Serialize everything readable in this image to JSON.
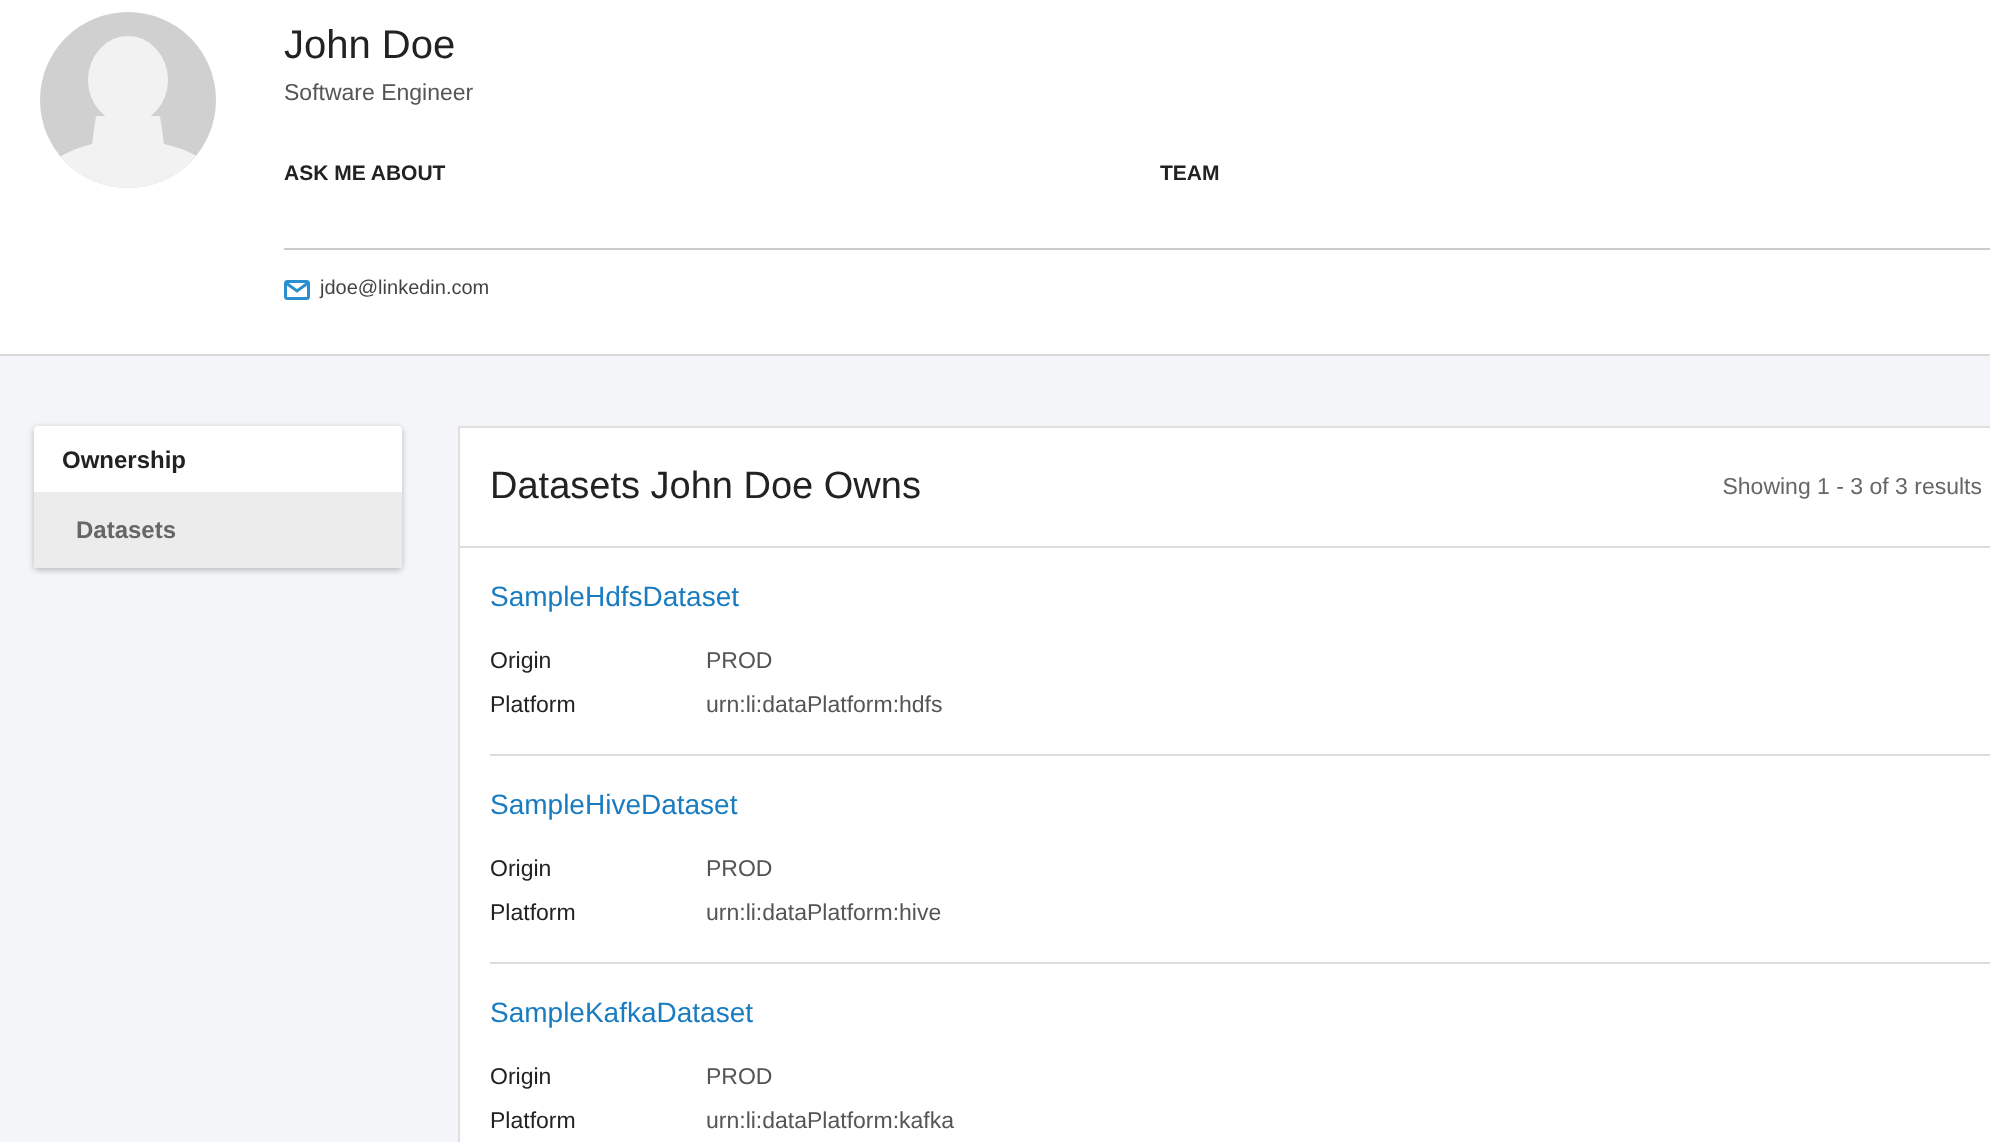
{
  "profile": {
    "name": "John Doe",
    "title": "Software Engineer",
    "sections": [
      "ASK ME ABOUT",
      "TEAM"
    ],
    "email": "jdoe@linkedin.com"
  },
  "sidebar": {
    "heading": "Ownership",
    "items": [
      {
        "label": "Datasets",
        "selected": true
      }
    ]
  },
  "datasets": {
    "title": "Datasets John Doe Owns",
    "summary": "Showing 1 - 3 of 3 results",
    "items": [
      {
        "name": "SampleHdfsDataset",
        "fields": [
          {
            "label": "Origin",
            "value": "PROD"
          },
          {
            "label": "Platform",
            "value": "urn:li:dataPlatform:hdfs"
          }
        ]
      },
      {
        "name": "SampleHiveDataset",
        "fields": [
          {
            "label": "Origin",
            "value": "PROD"
          },
          {
            "label": "Platform",
            "value": "urn:li:dataPlatform:hive"
          }
        ]
      },
      {
        "name": "SampleKafkaDataset",
        "fields": [
          {
            "label": "Origin",
            "value": "PROD"
          },
          {
            "label": "Platform",
            "value": "urn:li:dataPlatform:kafka"
          }
        ]
      }
    ]
  }
}
